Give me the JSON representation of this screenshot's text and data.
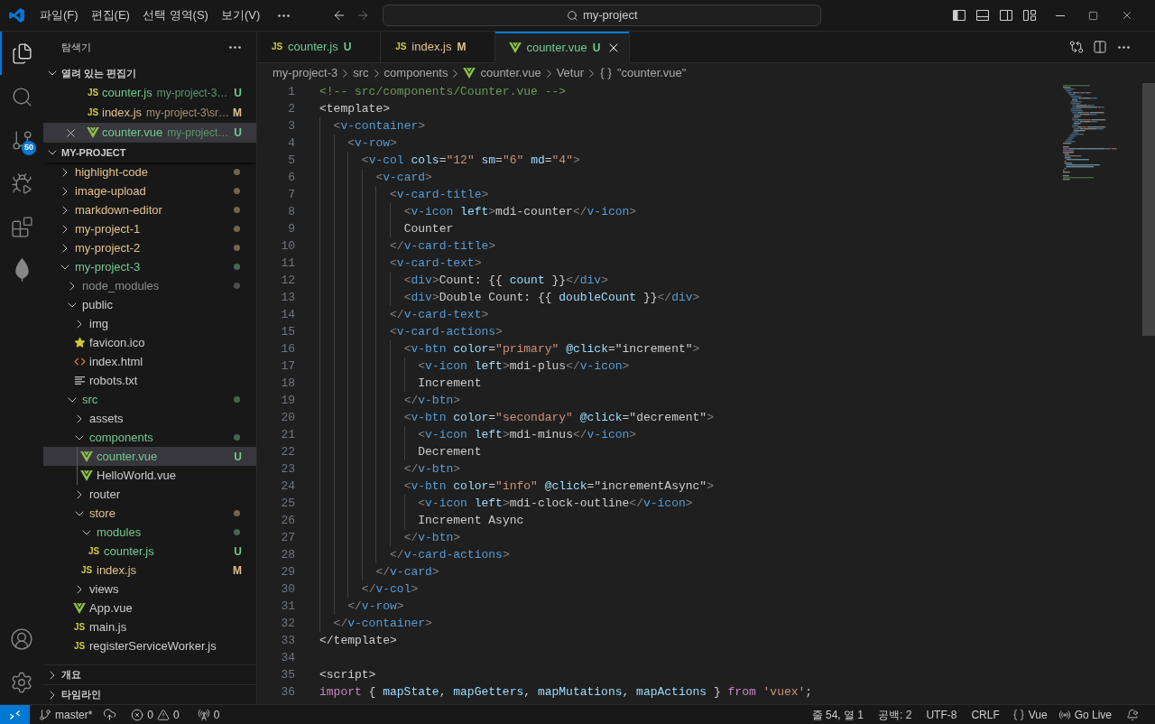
{
  "title_bar": {
    "menus": [
      "파일(F)",
      "편집(E)",
      "선택 영역(S)",
      "보기(V)"
    ],
    "nav_buttons": [
      {
        "kind": "back",
        "disabled": false
      },
      {
        "kind": "forward",
        "disabled": true
      }
    ],
    "command_center": {
      "text": "my-project"
    },
    "layout_toggles": [
      {
        "kind": "primary-sidebar",
        "on": true
      },
      {
        "kind": "panel",
        "on": false
      },
      {
        "kind": "secondary-sidebar",
        "on": false
      },
      {
        "kind": "customize"
      }
    ]
  },
  "activity_bar": {
    "items": [
      {
        "kind": "explorer",
        "selected": true
      },
      {
        "kind": "search",
        "selected": false
      },
      {
        "kind": "source-control",
        "selected": false,
        "badge": "50"
      },
      {
        "kind": "run-debug",
        "selected": false
      },
      {
        "kind": "extensions",
        "selected": false
      },
      {
        "kind": "leaf",
        "selected": false
      }
    ],
    "bottom_items": [
      {
        "kind": "account"
      },
      {
        "kind": "manage"
      }
    ]
  },
  "sidebar": {
    "title": "탐색기",
    "open_editors": {
      "title": "열려 있는 편집기",
      "expanded": true,
      "items": [
        {
          "name": "counter.js",
          "description": "my-project-3…",
          "kind": "js-file",
          "icon_label": "JS",
          "color": "#73c991",
          "badge": "U",
          "selected": false
        },
        {
          "name": "index.js",
          "description": "my-project-3\\sr…",
          "kind": "js-file",
          "icon_label": "JS",
          "color": "#e2c08d",
          "badge": "M",
          "selected": false
        },
        {
          "name": "counter.vue",
          "description": "my-project…",
          "kind": "vue-file",
          "color": "#73c991",
          "badge": "U",
          "selected": true
        }
      ]
    },
    "project": {
      "title": "MY-PROJECT",
      "expanded": true,
      "tree": [
        {
          "name": "highlight-code",
          "kind": "folder",
          "expanded": false,
          "color": "#e2c08d",
          "git_dot": true,
          "selected": false
        },
        {
          "name": "image-upload",
          "kind": "folder",
          "expanded": false,
          "color": "#e2c08d",
          "git_dot": true,
          "selected": false
        },
        {
          "name": "markdown-editor",
          "kind": "folder",
          "expanded": false,
          "color": "#e2c08d",
          "git_dot": true,
          "selected": false
        },
        {
          "name": "my-project-1",
          "kind": "folder",
          "expanded": false,
          "color": "#e2c08d",
          "git_dot": true,
          "selected": false
        },
        {
          "name": "my-project-2",
          "kind": "folder",
          "expanded": false,
          "color": "#e2c08d",
          "git_dot": true,
          "selected": false
        },
        {
          "name": "my-project-3",
          "kind": "folder",
          "expanded": true,
          "color": "#73c991",
          "git_dot": true,
          "selected": false,
          "children": [
            {
              "name": "node_modules",
              "kind": "folder",
              "expanded": false,
              "color": "#8c8c8c",
              "git_dot": true,
              "selected": false
            },
            {
              "name": "public",
              "kind": "folder",
              "expanded": true,
              "color": "#cccccc",
              "git_dot": false,
              "selected": false,
              "children": [
                {
                  "name": "img",
                  "kind": "folder",
                  "expanded": false,
                  "color": "#cccccc",
                  "git_dot": false,
                  "selected": false
                },
                {
                  "name": "favicon.ico",
                  "kind": "star-file",
                  "color": "#cccccc",
                  "selected": false
                },
                {
                  "name": "index.html",
                  "kind": "html-file",
                  "color": "#cccccc",
                  "selected": false
                },
                {
                  "name": "robots.txt",
                  "kind": "text-file",
                  "color": "#cccccc",
                  "selected": false
                }
              ]
            },
            {
              "name": "src",
              "kind": "folder",
              "expanded": true,
              "color": "#73c991",
              "git_dot": true,
              "selected": false,
              "children": [
                {
                  "name": "assets",
                  "kind": "folder",
                  "expanded": false,
                  "color": "#cccccc",
                  "git_dot": false,
                  "selected": false
                },
                {
                  "name": "components",
                  "kind": "folder",
                  "expanded": true,
                  "color": "#73c991",
                  "git_dot": true,
                  "selected": false,
                  "children": [
                    {
                      "name": "counter.vue",
                      "kind": "vue-file",
                      "color": "#73c991",
                      "badge": "U",
                      "selected": true
                    },
                    {
                      "name": "HelloWorld.vue",
                      "kind": "vue-file",
                      "color": "#cccccc",
                      "selected": false
                    }
                  ]
                },
                {
                  "name": "router",
                  "kind": "folder",
                  "expanded": false,
                  "color": "#cccccc",
                  "git_dot": false,
                  "selected": false
                },
                {
                  "name": "store",
                  "kind": "folder",
                  "expanded": true,
                  "color": "#e2c08d",
                  "git_dot": true,
                  "selected": false,
                  "children": [
                    {
                      "name": "modules",
                      "kind": "folder",
                      "expanded": true,
                      "color": "#73c991",
                      "git_dot": true,
                      "selected": false,
                      "children": [
                        {
                          "name": "counter.js",
                          "kind": "js-file",
                          "icon_label": "JS",
                          "color": "#73c991",
                          "badge": "U",
                          "selected": false
                        }
                      ]
                    },
                    {
                      "name": "index.js",
                      "kind": "js-file",
                      "icon_label": "JS",
                      "color": "#e2c08d",
                      "badge": "M",
                      "selected": false
                    }
                  ]
                },
                {
                  "name": "views",
                  "kind": "folder",
                  "expanded": false,
                  "color": "#cccccc",
                  "git_dot": false,
                  "selected": false
                },
                {
                  "name": "App.vue",
                  "kind": "vue-file",
                  "color": "#cccccc",
                  "selected": false
                },
                {
                  "name": "main.js",
                  "kind": "js-file",
                  "icon_label": "JS",
                  "color": "#cccccc",
                  "selected": false
                },
                {
                  "name": "registerServiceWorker.js",
                  "kind": "js-file",
                  "icon_label": "JS",
                  "color": "#cccccc",
                  "selected": false
                }
              ]
            }
          ]
        }
      ]
    },
    "sections": [
      {
        "title": "개요",
        "expanded": false
      },
      {
        "title": "타임라인",
        "expanded": false
      }
    ]
  },
  "editor": {
    "tabs": [
      {
        "name": "counter.js",
        "kind": "js-file",
        "icon_label": "JS",
        "color": "#73c991",
        "badge": "U",
        "selected": false
      },
      {
        "name": "index.js",
        "kind": "js-file",
        "icon_label": "JS",
        "color": "#e2c08d",
        "badge": "M",
        "selected": false
      },
      {
        "name": "counter.vue",
        "kind": "vue-file",
        "color": "#73c991",
        "badge": "U",
        "selected": true
      }
    ],
    "breadcrumb": [
      {
        "text": "my-project-3"
      },
      {
        "text": "src"
      },
      {
        "text": "components"
      },
      {
        "text": "counter.vue",
        "kind": "vue-file"
      },
      {
        "text": "Vetur"
      },
      {
        "text": "\"counter.vue\"",
        "kind": "symbol"
      }
    ],
    "lines": [
      {
        "number": "1",
        "tokens": [
          {
            "kind": "comment",
            "text": "<!-- src/components/Counter.vue -->"
          }
        ]
      },
      {
        "number": "2",
        "tokens": [
          {
            "kind": "text",
            "text": "<template>"
          }
        ]
      },
      {
        "number": "3",
        "tokens": [
          {
            "kind": "bracket",
            "text": "  <"
          },
          {
            "kind": "tag",
            "text": "v-container"
          },
          {
            "kind": "bracket",
            "text": ">"
          }
        ]
      },
      {
        "number": "4",
        "tokens": [
          {
            "kind": "bracket",
            "text": "    <"
          },
          {
            "kind": "tag",
            "text": "v-row"
          },
          {
            "kind": "bracket",
            "text": ">"
          }
        ]
      },
      {
        "number": "5",
        "tokens": [
          {
            "kind": "bracket",
            "text": "      <"
          },
          {
            "kind": "tag",
            "text": "v-col"
          },
          {
            "kind": "attr",
            "text": " cols"
          },
          {
            "kind": "text",
            "text": "="
          },
          {
            "kind": "string",
            "text": "\"12\""
          },
          {
            "kind": "attr",
            "text": " sm"
          },
          {
            "kind": "text",
            "text": "="
          },
          {
            "kind": "string",
            "text": "\"6\""
          },
          {
            "kind": "attr",
            "text": " md"
          },
          {
            "kind": "text",
            "text": "="
          },
          {
            "kind": "string",
            "text": "\"4\""
          },
          {
            "kind": "bracket",
            "text": ">"
          }
        ]
      },
      {
        "number": "6",
        "tokens": [
          {
            "kind": "bracket",
            "text": "        <"
          },
          {
            "kind": "tag",
            "text": "v-card"
          },
          {
            "kind": "bracket",
            "text": ">"
          }
        ]
      },
      {
        "number": "7",
        "tokens": [
          {
            "kind": "bracket",
            "text": "          <"
          },
          {
            "kind": "tag",
            "text": "v-card-title"
          },
          {
            "kind": "bracket",
            "text": ">"
          }
        ]
      },
      {
        "number": "8",
        "tokens": [
          {
            "kind": "bracket",
            "text": "            <"
          },
          {
            "kind": "tag",
            "text": "v-icon"
          },
          {
            "kind": "attr",
            "text": " left"
          },
          {
            "kind": "bracket",
            "text": ">"
          },
          {
            "kind": "text",
            "text": "mdi-counter"
          },
          {
            "kind": "bracket",
            "text": "</"
          },
          {
            "kind": "tag",
            "text": "v-icon"
          },
          {
            "kind": "bracket",
            "text": ">"
          }
        ]
      },
      {
        "number": "9",
        "tokens": [
          {
            "kind": "text",
            "text": "            Counter"
          }
        ]
      },
      {
        "number": "10",
        "tokens": [
          {
            "kind": "bracket",
            "text": "          </"
          },
          {
            "kind": "tag",
            "text": "v-card-title"
          },
          {
            "kind": "bracket",
            "text": ">"
          }
        ]
      },
      {
        "number": "11",
        "tokens": [
          {
            "kind": "bracket",
            "text": "          <"
          },
          {
            "kind": "tag",
            "text": "v-card-text"
          },
          {
            "kind": "bracket",
            "text": ">"
          }
        ]
      },
      {
        "number": "12",
        "tokens": [
          {
            "kind": "bracket",
            "text": "            <"
          },
          {
            "kind": "tag",
            "text": "div"
          },
          {
            "kind": "bracket",
            "text": ">"
          },
          {
            "kind": "text",
            "text": "Count: {{ "
          },
          {
            "kind": "var",
            "text": "count"
          },
          {
            "kind": "text",
            "text": " }}"
          },
          {
            "kind": "bracket",
            "text": "</"
          },
          {
            "kind": "tag",
            "text": "div"
          },
          {
            "kind": "bracket",
            "text": ">"
          }
        ]
      },
      {
        "number": "13",
        "tokens": [
          {
            "kind": "bracket",
            "text": "            <"
          },
          {
            "kind": "tag",
            "text": "div"
          },
          {
            "kind": "bracket",
            "text": ">"
          },
          {
            "kind": "text",
            "text": "Double Count: {{ "
          },
          {
            "kind": "var",
            "text": "doubleCount"
          },
          {
            "kind": "text",
            "text": " }}"
          },
          {
            "kind": "bracket",
            "text": "</"
          },
          {
            "kind": "tag",
            "text": "div"
          },
          {
            "kind": "bracket",
            "text": ">"
          }
        ]
      },
      {
        "number": "14",
        "tokens": [
          {
            "kind": "bracket",
            "text": "          </"
          },
          {
            "kind": "tag",
            "text": "v-card-text"
          },
          {
            "kind": "bracket",
            "text": ">"
          }
        ]
      },
      {
        "number": "15",
        "tokens": [
          {
            "kind": "bracket",
            "text": "          <"
          },
          {
            "kind": "tag",
            "text": "v-card-actions"
          },
          {
            "kind": "bracket",
            "text": ">"
          }
        ]
      },
      {
        "number": "16",
        "tokens": [
          {
            "kind": "bracket",
            "text": "            <"
          },
          {
            "kind": "tag",
            "text": "v-btn"
          },
          {
            "kind": "attr",
            "text": " color"
          },
          {
            "kind": "text",
            "text": "="
          },
          {
            "kind": "string",
            "text": "\"primary\""
          },
          {
            "kind": "attr",
            "text": " @click"
          },
          {
            "kind": "text",
            "text": "=\"increment\""
          },
          {
            "kind": "bracket",
            "text": ">"
          }
        ]
      },
      {
        "number": "17",
        "tokens": [
          {
            "kind": "bracket",
            "text": "              <"
          },
          {
            "kind": "tag",
            "text": "v-icon"
          },
          {
            "kind": "attr",
            "text": " left"
          },
          {
            "kind": "bracket",
            "text": ">"
          },
          {
            "kind": "text",
            "text": "mdi-plus"
          },
          {
            "kind": "bracket",
            "text": "</"
          },
          {
            "kind": "tag",
            "text": "v-icon"
          },
          {
            "kind": "bracket",
            "text": ">"
          }
        ]
      },
      {
        "number": "18",
        "tokens": [
          {
            "kind": "text",
            "text": "              Increment"
          }
        ]
      },
      {
        "number": "19",
        "tokens": [
          {
            "kind": "bracket",
            "text": "            </"
          },
          {
            "kind": "tag",
            "text": "v-btn"
          },
          {
            "kind": "bracket",
            "text": ">"
          }
        ]
      },
      {
        "number": "20",
        "tokens": [
          {
            "kind": "bracket",
            "text": "            <"
          },
          {
            "kind": "tag",
            "text": "v-btn"
          },
          {
            "kind": "attr",
            "text": " color"
          },
          {
            "kind": "text",
            "text": "="
          },
          {
            "kind": "string",
            "text": "\"secondary\""
          },
          {
            "kind": "attr",
            "text": " @click"
          },
          {
            "kind": "text",
            "text": "=\"decrement\""
          },
          {
            "kind": "bracket",
            "text": ">"
          }
        ]
      },
      {
        "number": "21",
        "tokens": [
          {
            "kind": "bracket",
            "text": "              <"
          },
          {
            "kind": "tag",
            "text": "v-icon"
          },
          {
            "kind": "attr",
            "text": " left"
          },
          {
            "kind": "bracket",
            "text": ">"
          },
          {
            "kind": "text",
            "text": "mdi-minus"
          },
          {
            "kind": "bracket",
            "text": "</"
          },
          {
            "kind": "tag",
            "text": "v-icon"
          },
          {
            "kind": "bracket",
            "text": ">"
          }
        ]
      },
      {
        "number": "22",
        "tokens": [
          {
            "kind": "text",
            "text": "              Decrement"
          }
        ]
      },
      {
        "number": "23",
        "tokens": [
          {
            "kind": "bracket",
            "text": "            </"
          },
          {
            "kind": "tag",
            "text": "v-btn"
          },
          {
            "kind": "bracket",
            "text": ">"
          }
        ]
      },
      {
        "number": "24",
        "tokens": [
          {
            "kind": "bracket",
            "text": "            <"
          },
          {
            "kind": "tag",
            "text": "v-btn"
          },
          {
            "kind": "attr",
            "text": " color"
          },
          {
            "kind": "text",
            "text": "="
          },
          {
            "kind": "string",
            "text": "\"info\""
          },
          {
            "kind": "attr",
            "text": " @click"
          },
          {
            "kind": "text",
            "text": "=\"incrementAsync\""
          },
          {
            "kind": "bracket",
            "text": ">"
          }
        ]
      },
      {
        "number": "25",
        "tokens": [
          {
            "kind": "bracket",
            "text": "              <"
          },
          {
            "kind": "tag",
            "text": "v-icon"
          },
          {
            "kind": "attr",
            "text": " left"
          },
          {
            "kind": "bracket",
            "text": ">"
          },
          {
            "kind": "text",
            "text": "mdi-clock-outline"
          },
          {
            "kind": "bracket",
            "text": "</"
          },
          {
            "kind": "tag",
            "text": "v-icon"
          },
          {
            "kind": "bracket",
            "text": ">"
          }
        ]
      },
      {
        "number": "26",
        "tokens": [
          {
            "kind": "text",
            "text": "              Increment Async"
          }
        ]
      },
      {
        "number": "27",
        "tokens": [
          {
            "kind": "bracket",
            "text": "            </"
          },
          {
            "kind": "tag",
            "text": "v-btn"
          },
          {
            "kind": "bracket",
            "text": ">"
          }
        ]
      },
      {
        "number": "28",
        "tokens": [
          {
            "kind": "bracket",
            "text": "          </"
          },
          {
            "kind": "tag",
            "text": "v-card-actions"
          },
          {
            "kind": "bracket",
            "text": ">"
          }
        ]
      },
      {
        "number": "29",
        "tokens": [
          {
            "kind": "bracket",
            "text": "        </"
          },
          {
            "kind": "tag",
            "text": "v-card"
          },
          {
            "kind": "bracket",
            "text": ">"
          }
        ]
      },
      {
        "number": "30",
        "tokens": [
          {
            "kind": "bracket",
            "text": "      </"
          },
          {
            "kind": "tag",
            "text": "v-col"
          },
          {
            "kind": "bracket",
            "text": ">"
          }
        ]
      },
      {
        "number": "31",
        "tokens": [
          {
            "kind": "bracket",
            "text": "    </"
          },
          {
            "kind": "tag",
            "text": "v-row"
          },
          {
            "kind": "bracket",
            "text": ">"
          }
        ]
      },
      {
        "number": "32",
        "tokens": [
          {
            "kind": "bracket",
            "text": "  </"
          },
          {
            "kind": "tag",
            "text": "v-container"
          },
          {
            "kind": "bracket",
            "text": ">"
          }
        ]
      },
      {
        "number": "33",
        "tokens": [
          {
            "kind": "text",
            "text": "</template>"
          }
        ]
      },
      {
        "number": "34"
      },
      {
        "number": "35",
        "tokens": [
          {
            "kind": "text",
            "text": "<script>"
          }
        ]
      },
      {
        "number": "36",
        "tokens": [
          {
            "kind": "keyword",
            "text": "import"
          },
          {
            "kind": "text",
            "text": " { "
          },
          {
            "kind": "var",
            "text": "mapState"
          },
          {
            "kind": "text",
            "text": ", "
          },
          {
            "kind": "var",
            "text": "mapGetters"
          },
          {
            "kind": "text",
            "text": ", "
          },
          {
            "kind": "var",
            "text": "mapMutations"
          },
          {
            "kind": "text",
            "text": ", "
          },
          {
            "kind": "var",
            "text": "mapActions"
          },
          {
            "kind": "text",
            "text": " } "
          },
          {
            "kind": "keyword",
            "text": "from"
          },
          {
            "kind": "string",
            "text": " 'vuex'"
          },
          {
            "kind": "text",
            "text": ";"
          }
        ]
      }
    ]
  },
  "status_bar": {
    "left": [
      {
        "kind": "remote"
      },
      {
        "kind": "branch",
        "text": "master*"
      },
      {
        "kind": "sync"
      },
      {
        "kind": "problems",
        "errors": "0",
        "warnings": "0"
      },
      {
        "kind": "ports",
        "text": "0"
      }
    ],
    "right": [
      {
        "kind": "text",
        "text": "줄 54, 열 1"
      },
      {
        "kind": "text",
        "text": "공백: 2"
      },
      {
        "kind": "text",
        "text": "UTF-8"
      },
      {
        "kind": "text",
        "text": "CRLF"
      },
      {
        "kind": "language",
        "text": "Vue"
      },
      {
        "kind": "live-server",
        "text": "Go Live"
      },
      {
        "kind": "notifications"
      }
    ]
  }
}
